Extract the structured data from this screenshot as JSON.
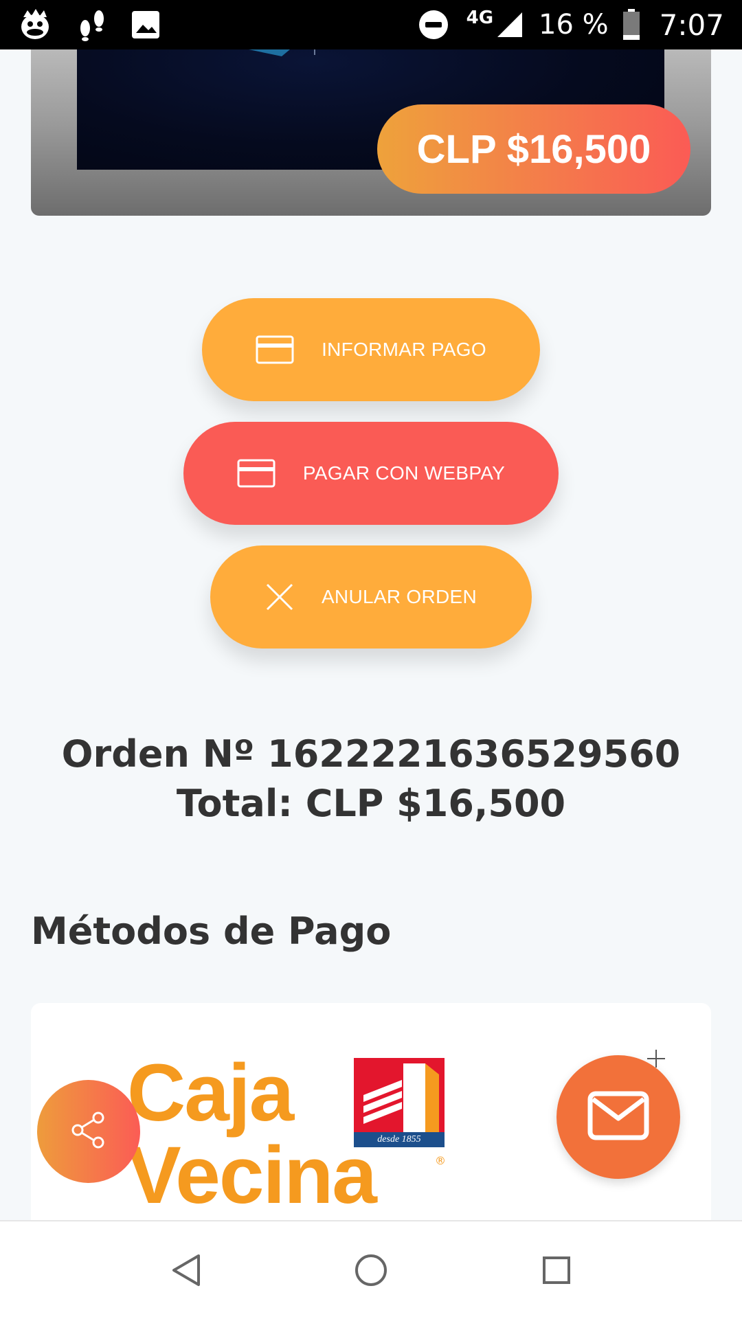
{
  "status_bar": {
    "network": "4G",
    "battery": "16 %",
    "time": "7:07",
    "icons": [
      "duck-app-icon",
      "footsteps-icon",
      "image-icon",
      "do-not-disturb-icon",
      "signal-icon",
      "battery-icon"
    ]
  },
  "product": {
    "price_badge": "CLP $16,500"
  },
  "actions": {
    "informar_pago": "INFORMAR PAGO",
    "pagar_webpay": "PAGAR CON WEBPAY",
    "anular_orden": "ANULAR ORDEN"
  },
  "order": {
    "number_line": "Orden Nº 1622221636529560",
    "total_line": "Total: CLP $16,500"
  },
  "payment_methods": {
    "title": "Métodos de Pago",
    "items": [
      {
        "logo_line1": "Caja",
        "logo_line2": "Vecina",
        "badge_text": "desde 1855",
        "registered": "®"
      }
    ]
  },
  "colors": {
    "orange_button": "#ffac3b",
    "red_button": "#fa5b55",
    "mail_fab": "#f2713a",
    "caja_vecina_orange": "#f59a1f",
    "text_dark": "#333333"
  },
  "navigation": {
    "icons": [
      "back-icon",
      "home-icon",
      "recents-icon"
    ]
  }
}
